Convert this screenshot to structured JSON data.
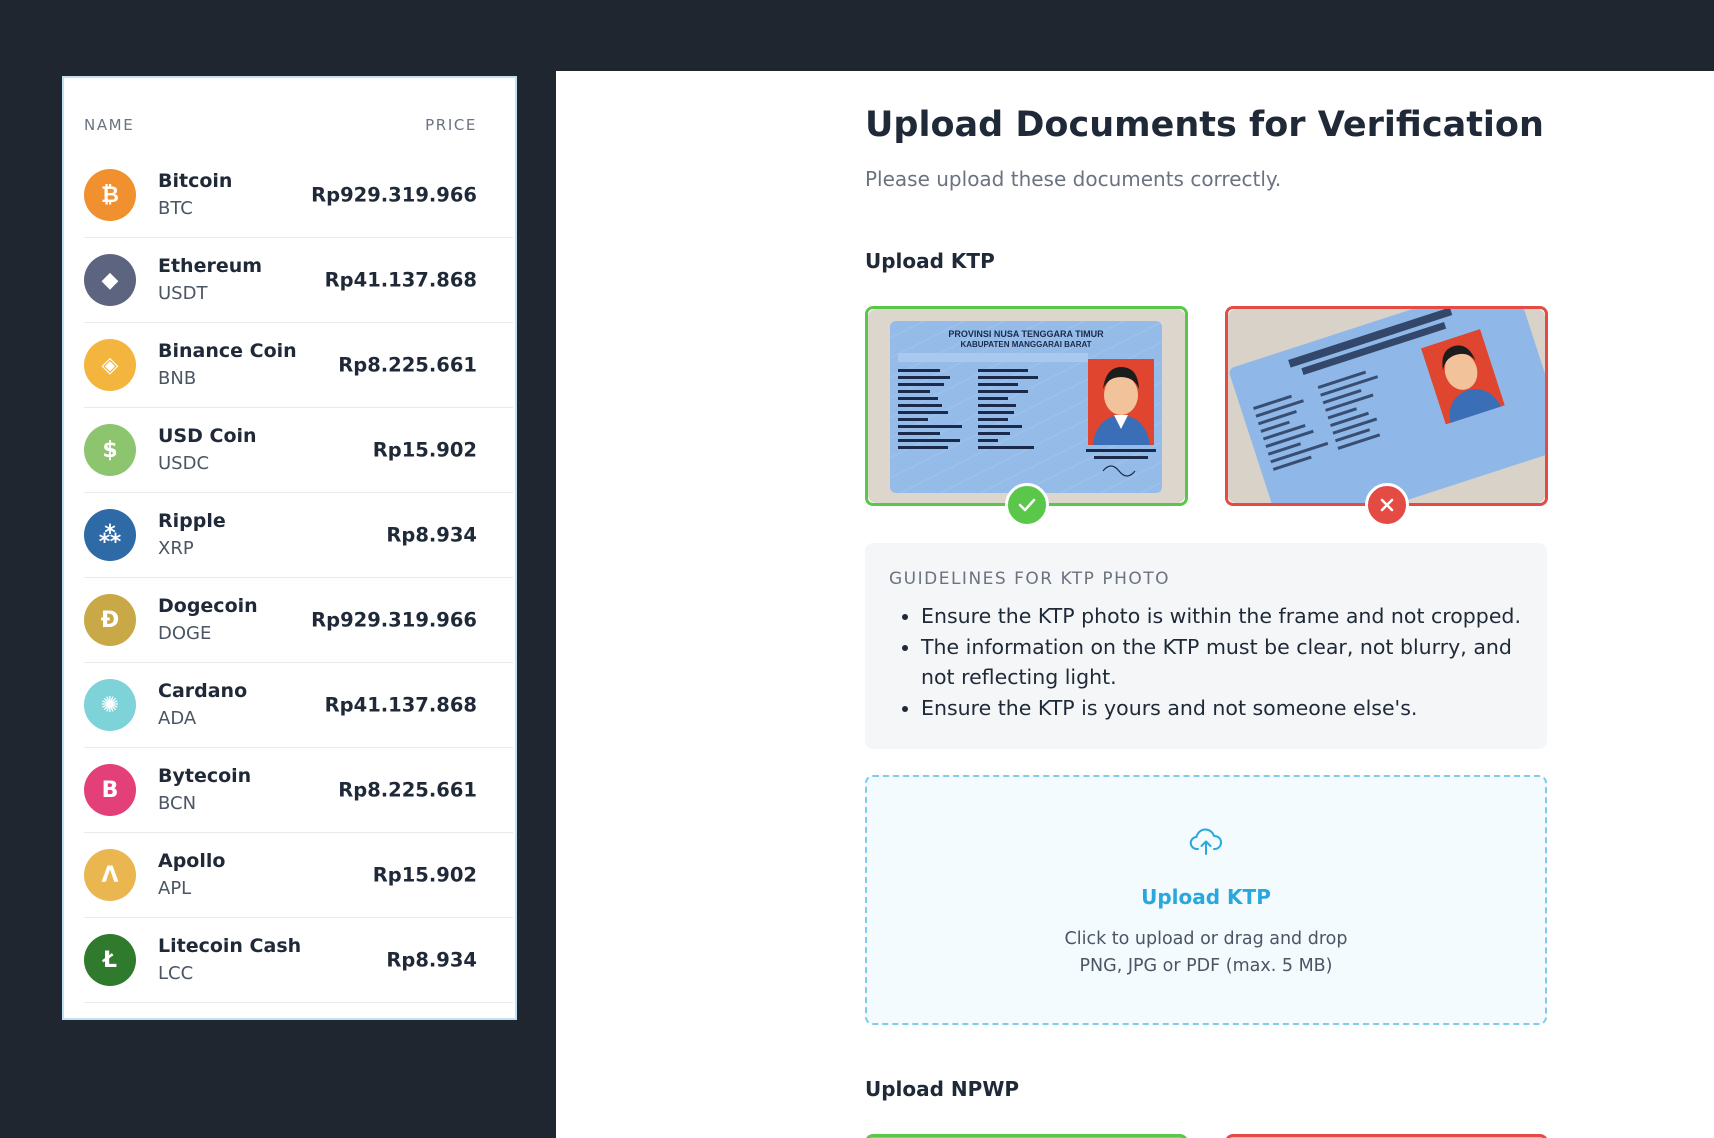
{
  "crypto_list": {
    "header_name": "NAME",
    "header_price": "PRICE",
    "items": [
      {
        "name": "Bitcoin",
        "symbol": "BTC",
        "price": "Rp929.319.966",
        "icon": "bitcoin-icon",
        "color": "#f1902e",
        "glyph": "₿"
      },
      {
        "name": "Ethereum",
        "symbol": "USDT",
        "price": "Rp41.137.868",
        "icon": "ethereum-icon",
        "color": "#5d6480",
        "glyph": "◆"
      },
      {
        "name": "Binance Coin",
        "symbol": "BNB",
        "price": "Rp8.225.661",
        "icon": "binance-icon",
        "color": "#f3b53e",
        "glyph": "◈"
      },
      {
        "name": "USD Coin",
        "symbol": "USDC",
        "price": "Rp15.902",
        "icon": "usd-coin-icon",
        "color": "#8cc56e",
        "glyph": "$"
      },
      {
        "name": "Ripple",
        "symbol": "XRP",
        "price": "Rp8.934",
        "icon": "ripple-icon",
        "color": "#2d6aa6",
        "glyph": "⁂"
      },
      {
        "name": "Dogecoin",
        "symbol": "DOGE",
        "price": "Rp929.319.966",
        "icon": "dogecoin-icon",
        "color": "#c9a847",
        "glyph": "Ð"
      },
      {
        "name": "Cardano",
        "symbol": "ADA",
        "price": "Rp41.137.868",
        "icon": "cardano-icon",
        "color": "#7dd3d8",
        "glyph": "✺"
      },
      {
        "name": "Bytecoin",
        "symbol": "BCN",
        "price": "Rp8.225.661",
        "icon": "bytecoin-icon",
        "color": "#e3407a",
        "glyph": "B"
      },
      {
        "name": "Apollo",
        "symbol": "APL",
        "price": "Rp15.902",
        "icon": "apollo-icon",
        "color": "#e9b64f",
        "glyph": "Λ"
      },
      {
        "name": "Litecoin Cash",
        "symbol": "LCC",
        "price": "Rp8.934",
        "icon": "litecoin-cash-icon",
        "color": "#2f7a2c",
        "glyph": "Ł"
      }
    ]
  },
  "upload_page": {
    "title": "Upload Documents for Verification",
    "subtitle": "Please upload these documents correctly.",
    "ktp_section_title": "Upload KTP",
    "ktp_card": {
      "province": "PROVINSI NUSA TENGGARA TIMUR",
      "regency": "KABUPATEN MANGGARAI BARAT"
    },
    "guidelines": {
      "title": "GUIDELINES FOR KTP PHOTO",
      "items": [
        "Ensure the KTP photo is within the frame and not cropped.",
        "The information on the KTP must be clear, not blurry, and not reflecting light.",
        "Ensure the KTP is yours and not someone else's."
      ]
    },
    "dropzone": {
      "label": "Upload KTP",
      "hint": "Click to upload or drag and drop",
      "formats": "PNG, JPG or PDF (max. 5 MB)"
    },
    "npwp_section_title": "Upload NPWP",
    "colors": {
      "good": "#5bc74a",
      "bad": "#e44b45",
      "accent": "#2aa7dc"
    }
  }
}
